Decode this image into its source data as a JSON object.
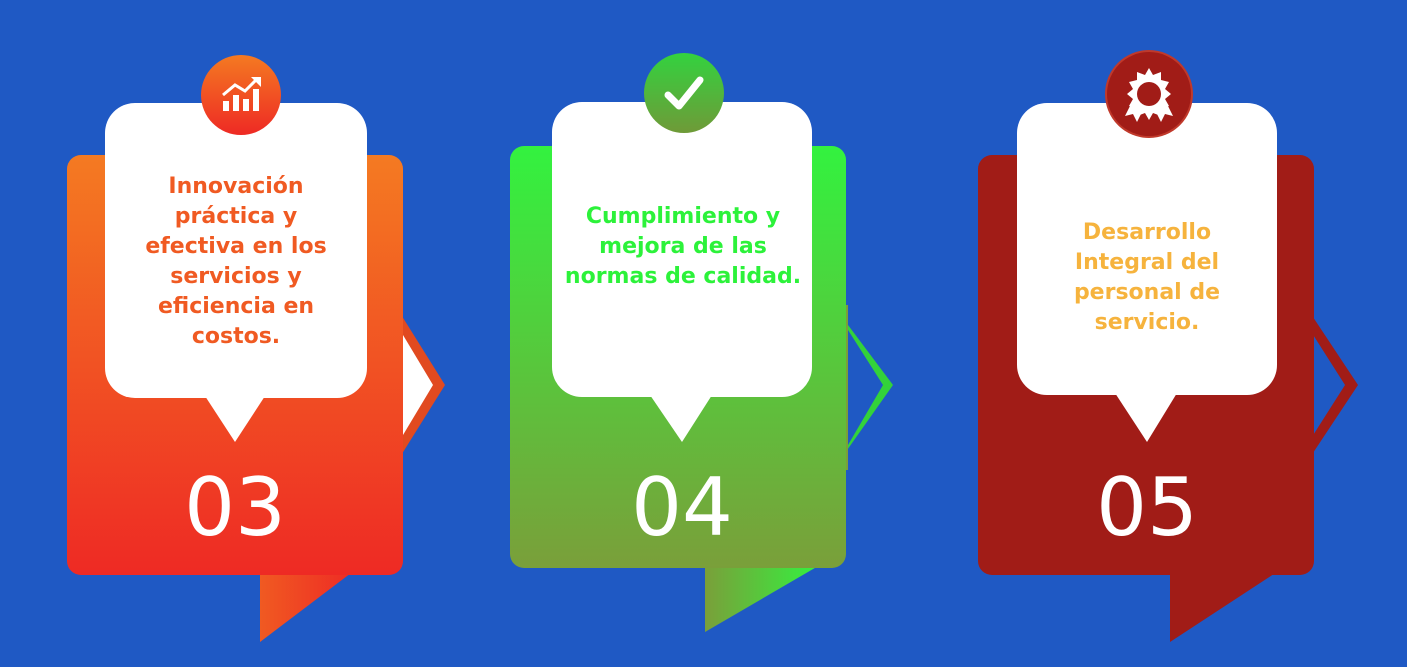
{
  "steps": [
    {
      "number": "03",
      "text": "Innovación práctica y efectiva en los servicios y eficiencia en costos.",
      "icon": "growth-chart-icon",
      "text_color": "#f05a22",
      "colors": {
        "top": "#f47a22",
        "bottom": "#ee2a24",
        "dark": "#b5251b"
      }
    },
    {
      "number": "04",
      "text": "Cumplimiento y mejora de las normas de calidad.",
      "icon": "checkmark-icon",
      "text_color": "#2cf23a",
      "colors": {
        "top": "#33f23f",
        "bottom": "#7a9f3a",
        "dark": "#6f9a38"
      }
    },
    {
      "number": "05",
      "text": "Desarrollo Integral del personal de servicio.",
      "icon": "award-badge-icon",
      "text_color": "#f6b33d",
      "colors": {
        "top": "#a11c17",
        "bottom": "#a11c17",
        "dark": "#a11c17"
      }
    }
  ]
}
